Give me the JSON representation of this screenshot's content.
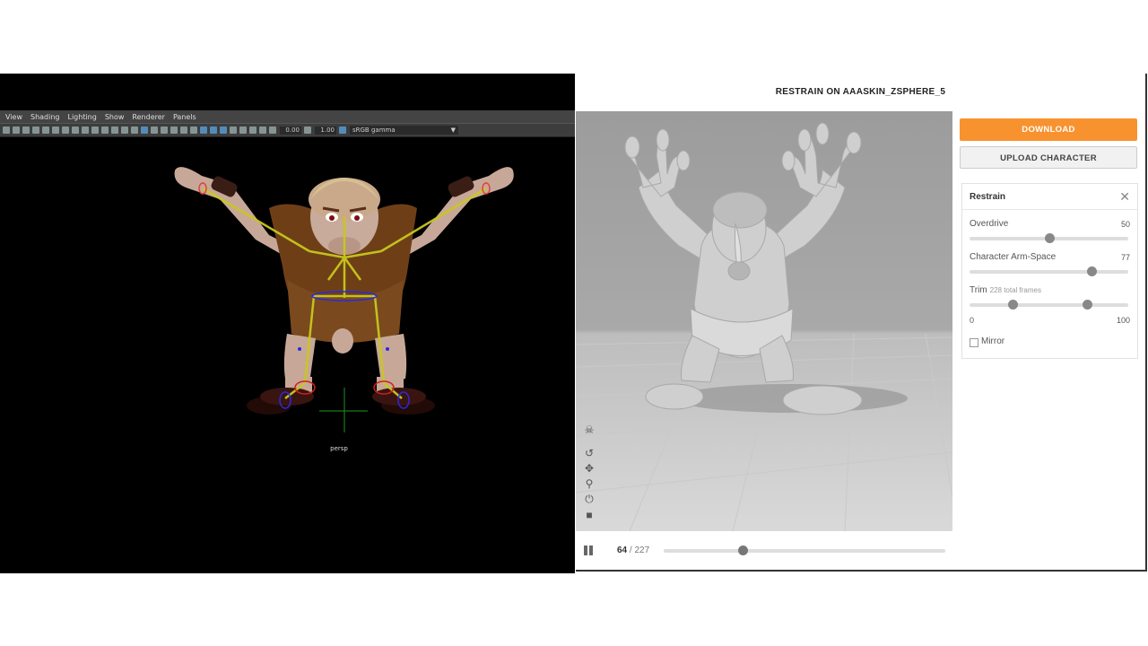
{
  "maya": {
    "menu": [
      "View",
      "Shading",
      "Lighting",
      "Show",
      "Renderer",
      "Panels"
    ],
    "toolbar": {
      "exposure": "0.00",
      "gamma": "1.00",
      "colorspace": "sRGB gamma"
    },
    "camera_label": "persp"
  },
  "web": {
    "title": "RESTRAIN ON AAASKIN_ZSPHERE_5",
    "download_label": "DOWNLOAD",
    "upload_label": "UPLOAD CHARACTER",
    "panel": {
      "title": "Restrain",
      "close": "✕",
      "overdrive": {
        "label": "Overdrive",
        "value": "50",
        "fraction": 0.5
      },
      "arm_space": {
        "label": "Character Arm-Space",
        "value": "77",
        "fraction": 0.77
      },
      "trim": {
        "label": "Trim",
        "frames_note": "228 total frames",
        "min_label": "0",
        "max_label": "100",
        "start_fraction": 0.27,
        "end_fraction": 0.74
      },
      "mirror_label": "Mirror"
    },
    "playback": {
      "current_frame": "64",
      "separator": " / ",
      "total_frames": "227",
      "progress": 0.28
    }
  }
}
